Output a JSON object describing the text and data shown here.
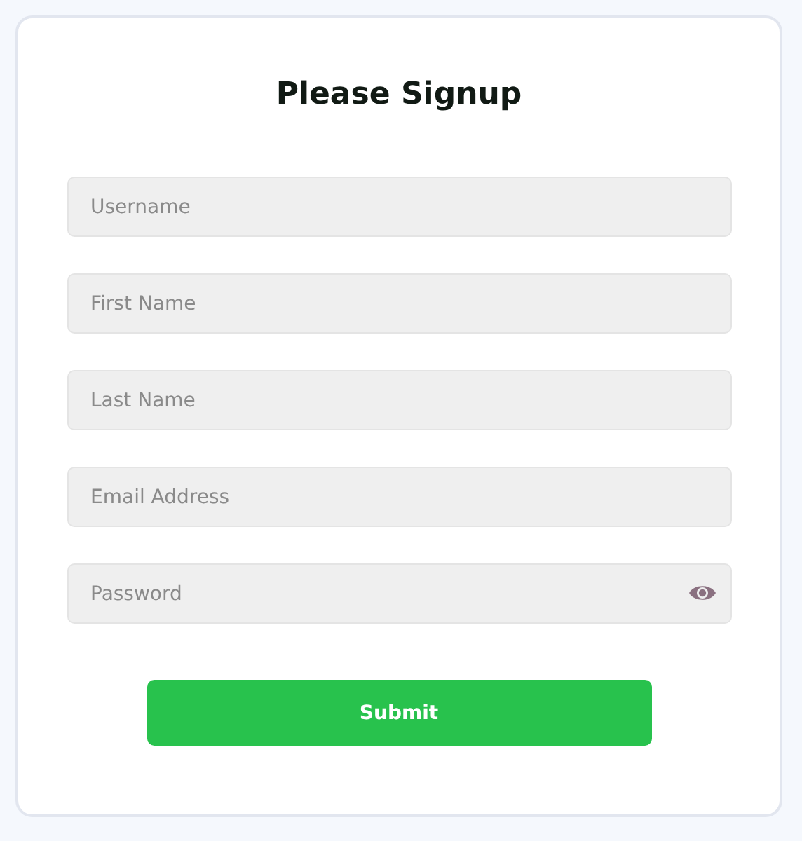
{
  "form": {
    "title": "Please Signup",
    "fields": [
      {
        "kind": "text",
        "placeholder": "Username"
      },
      {
        "kind": "text",
        "placeholder": "First Name"
      },
      {
        "kind": "text",
        "placeholder": "Last Name"
      },
      {
        "kind": "email",
        "placeholder": "Email Address"
      },
      {
        "kind": "password",
        "placeholder": "Password"
      }
    ],
    "submit": "Submit"
  }
}
